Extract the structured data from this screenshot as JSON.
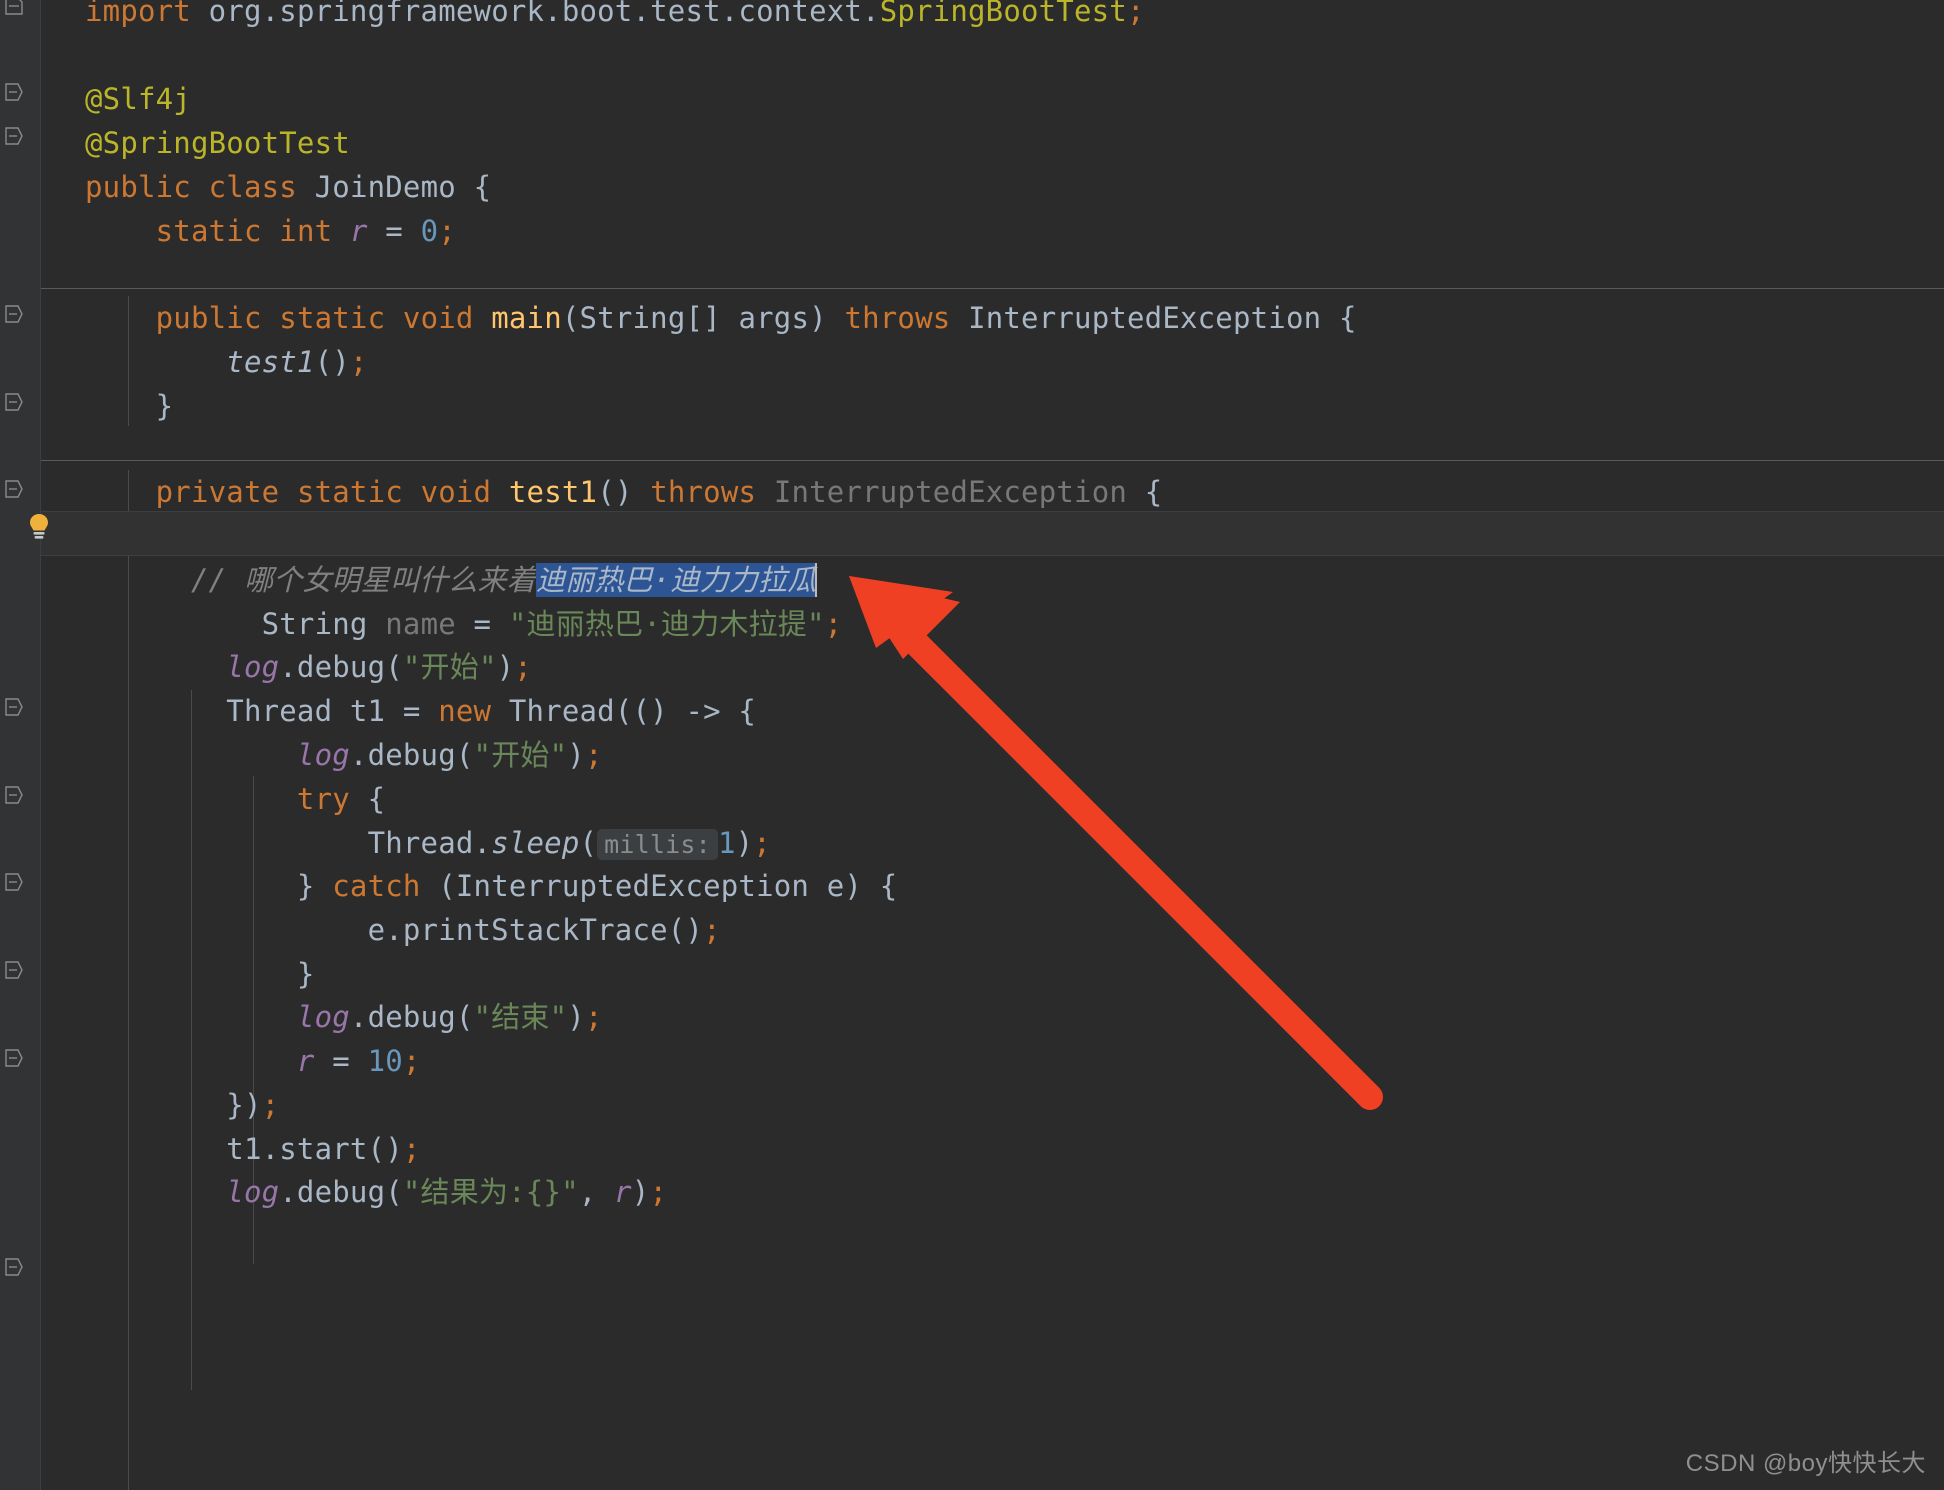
{
  "editor": {
    "theme": "Darcula",
    "background": "#2b2b2b",
    "gutter_background": "#313335",
    "caret_row_background": "#323232",
    "selection_color": "#2d5494",
    "arrow_color": "#f04023",
    "font_size_px": 29,
    "line_height_px": 44
  },
  "code_lines": [
    {
      "indent": 0,
      "tokens": [
        {
          "t": "import",
          "c": "kw"
        },
        {
          "t": " ",
          "c": "pln"
        },
        {
          "t": "org.springframework.boot.test.context.",
          "c": "pln"
        },
        {
          "t": "SpringBootTest",
          "c": "ann"
        },
        {
          "t": ";",
          "c": "semi"
        }
      ]
    },
    {
      "indent": 0,
      "tokens": []
    },
    {
      "indent": 0,
      "tokens": [
        {
          "t": "@Slf4j",
          "c": "ann"
        }
      ]
    },
    {
      "indent": 0,
      "tokens": [
        {
          "t": "@SpringBootTest",
          "c": "ann"
        }
      ]
    },
    {
      "indent": 0,
      "tokens": [
        {
          "t": "public",
          "c": "kw"
        },
        {
          "t": " ",
          "c": "pln"
        },
        {
          "t": "class",
          "c": "kw"
        },
        {
          "t": " ",
          "c": "pln"
        },
        {
          "t": "JoinDemo",
          "c": "cls"
        },
        {
          "t": " {",
          "c": "pln"
        }
      ]
    },
    {
      "indent": 1,
      "tokens": [
        {
          "t": "static",
          "c": "kw"
        },
        {
          "t": " ",
          "c": "pln"
        },
        {
          "t": "int",
          "c": "kw"
        },
        {
          "t": " ",
          "c": "pln"
        },
        {
          "t": "r",
          "c": "fld"
        },
        {
          "t": " = ",
          "c": "pln"
        },
        {
          "t": "0",
          "c": "num"
        },
        {
          "t": ";",
          "c": "semi"
        }
      ]
    },
    {
      "indent": 0,
      "tokens": []
    },
    {
      "indent": 1,
      "tokens": [
        {
          "t": "public",
          "c": "kw"
        },
        {
          "t": " ",
          "c": "pln"
        },
        {
          "t": "static",
          "c": "kw"
        },
        {
          "t": " ",
          "c": "pln"
        },
        {
          "t": "void",
          "c": "kw"
        },
        {
          "t": " ",
          "c": "pln"
        },
        {
          "t": "main",
          "c": "mth"
        },
        {
          "t": "(String[] args) ",
          "c": "pln"
        },
        {
          "t": "throws",
          "c": "kw"
        },
        {
          "t": " ",
          "c": "pln"
        },
        {
          "t": "InterruptedException",
          "c": "cls"
        },
        {
          "t": " {",
          "c": "pln"
        }
      ]
    },
    {
      "indent": 2,
      "tokens": [
        {
          "t": "test1",
          "c": "ital"
        },
        {
          "t": "()",
          "c": "pln"
        },
        {
          "t": ";",
          "c": "semi"
        }
      ]
    },
    {
      "indent": 1,
      "tokens": [
        {
          "t": "}",
          "c": "pln"
        }
      ]
    },
    {
      "indent": 0,
      "tokens": []
    },
    {
      "indent": 1,
      "tokens": [
        {
          "t": "private",
          "c": "kw"
        },
        {
          "t": " ",
          "c": "pln"
        },
        {
          "t": "static",
          "c": "kw"
        },
        {
          "t": " ",
          "c": "pln"
        },
        {
          "t": "void",
          "c": "kw"
        },
        {
          "t": " ",
          "c": "pln"
        },
        {
          "t": "test1",
          "c": "mth"
        },
        {
          "t": "() ",
          "c": "pln"
        },
        {
          "t": "throws",
          "c": "kw"
        },
        {
          "t": " ",
          "c": "pln"
        },
        {
          "t": "InterruptedException",
          "c": "gray"
        },
        {
          "t": " {",
          "c": "pln"
        }
      ]
    }
  ],
  "comment_line": {
    "prefix": "// 哪个女明星叫什么来着",
    "selected_text": "迪丽热巴·迪力力拉瓜",
    "has_caret": true,
    "gutter_icon": "lightbulb-icon"
  },
  "string_line": {
    "decl": "String",
    "var": "name",
    "assign": " = ",
    "value": "\"迪丽热巴·迪力木拉提\"",
    "terminator": ";"
  },
  "body_lines": [
    {
      "indent": 2,
      "tokens": [
        {
          "t": "log",
          "c": "sfld"
        },
        {
          "t": ".debug(",
          "c": "pln"
        },
        {
          "t": "\"开始\"",
          "c": "str"
        },
        {
          "t": ")",
          "c": "pln"
        },
        {
          "t": ";",
          "c": "semi"
        }
      ]
    },
    {
      "indent": 2,
      "tokens": [
        {
          "t": "Thread t1 = ",
          "c": "pln"
        },
        {
          "t": "new",
          "c": "kw"
        },
        {
          "t": " ",
          "c": "pln"
        },
        {
          "t": "Thread(() -> {",
          "c": "pln"
        }
      ]
    },
    {
      "indent": 3,
      "tokens": [
        {
          "t": "log",
          "c": "sfld"
        },
        {
          "t": ".debug(",
          "c": "pln"
        },
        {
          "t": "\"开始\"",
          "c": "str"
        },
        {
          "t": ")",
          "c": "pln"
        },
        {
          "t": ";",
          "c": "semi"
        }
      ]
    },
    {
      "indent": 3,
      "tokens": [
        {
          "t": "try",
          "c": "kw"
        },
        {
          "t": " {",
          "c": "pln"
        }
      ]
    },
    {
      "indent": 4,
      "tokens": [
        {
          "t": "Thread.",
          "c": "pln"
        },
        {
          "t": "sleep",
          "c": "ital"
        },
        {
          "t": "(",
          "c": "pln"
        },
        {
          "t": "millis:",
          "c": "hint"
        },
        {
          "t": "1",
          "c": "num"
        },
        {
          "t": ")",
          "c": "pln"
        },
        {
          "t": ";",
          "c": "semi"
        }
      ]
    },
    {
      "indent": 3,
      "tokens": [
        {
          "t": "} ",
          "c": "pln"
        },
        {
          "t": "catch",
          "c": "kw"
        },
        {
          "t": " (InterruptedException e) {",
          "c": "pln"
        }
      ]
    },
    {
      "indent": 4,
      "tokens": [
        {
          "t": "e.printStackTrace()",
          "c": "pln"
        },
        {
          "t": ";",
          "c": "semi"
        }
      ]
    },
    {
      "indent": 3,
      "tokens": [
        {
          "t": "}",
          "c": "pln"
        }
      ]
    },
    {
      "indent": 3,
      "tokens": [
        {
          "t": "log",
          "c": "sfld"
        },
        {
          "t": ".debug(",
          "c": "pln"
        },
        {
          "t": "\"结束\"",
          "c": "str"
        },
        {
          "t": ")",
          "c": "pln"
        },
        {
          "t": ";",
          "c": "semi"
        }
      ]
    },
    {
      "indent": 3,
      "tokens": [
        {
          "t": "r",
          "c": "fld"
        },
        {
          "t": " = ",
          "c": "pln"
        },
        {
          "t": "10",
          "c": "num"
        },
        {
          "t": ";",
          "c": "semi"
        }
      ]
    },
    {
      "indent": 2,
      "tokens": [
        {
          "t": "})",
          "c": "pln"
        },
        {
          "t": ";",
          "c": "semi"
        }
      ]
    },
    {
      "indent": 2,
      "tokens": [
        {
          "t": "t1.start()",
          "c": "pln"
        },
        {
          "t": ";",
          "c": "semi"
        }
      ]
    },
    {
      "indent": 2,
      "tokens": [
        {
          "t": "log",
          "c": "sfld"
        },
        {
          "t": ".debug(",
          "c": "pln"
        },
        {
          "t": "\"结果为:{}\"",
          "c": "str"
        },
        {
          "t": ", ",
          "c": "pln"
        },
        {
          "t": "r",
          "c": "fld"
        },
        {
          "t": ")",
          "c": "pln"
        },
        {
          "t": ";",
          "c": "semi"
        }
      ]
    }
  ],
  "watermark": "CSDN @boy快快长大"
}
